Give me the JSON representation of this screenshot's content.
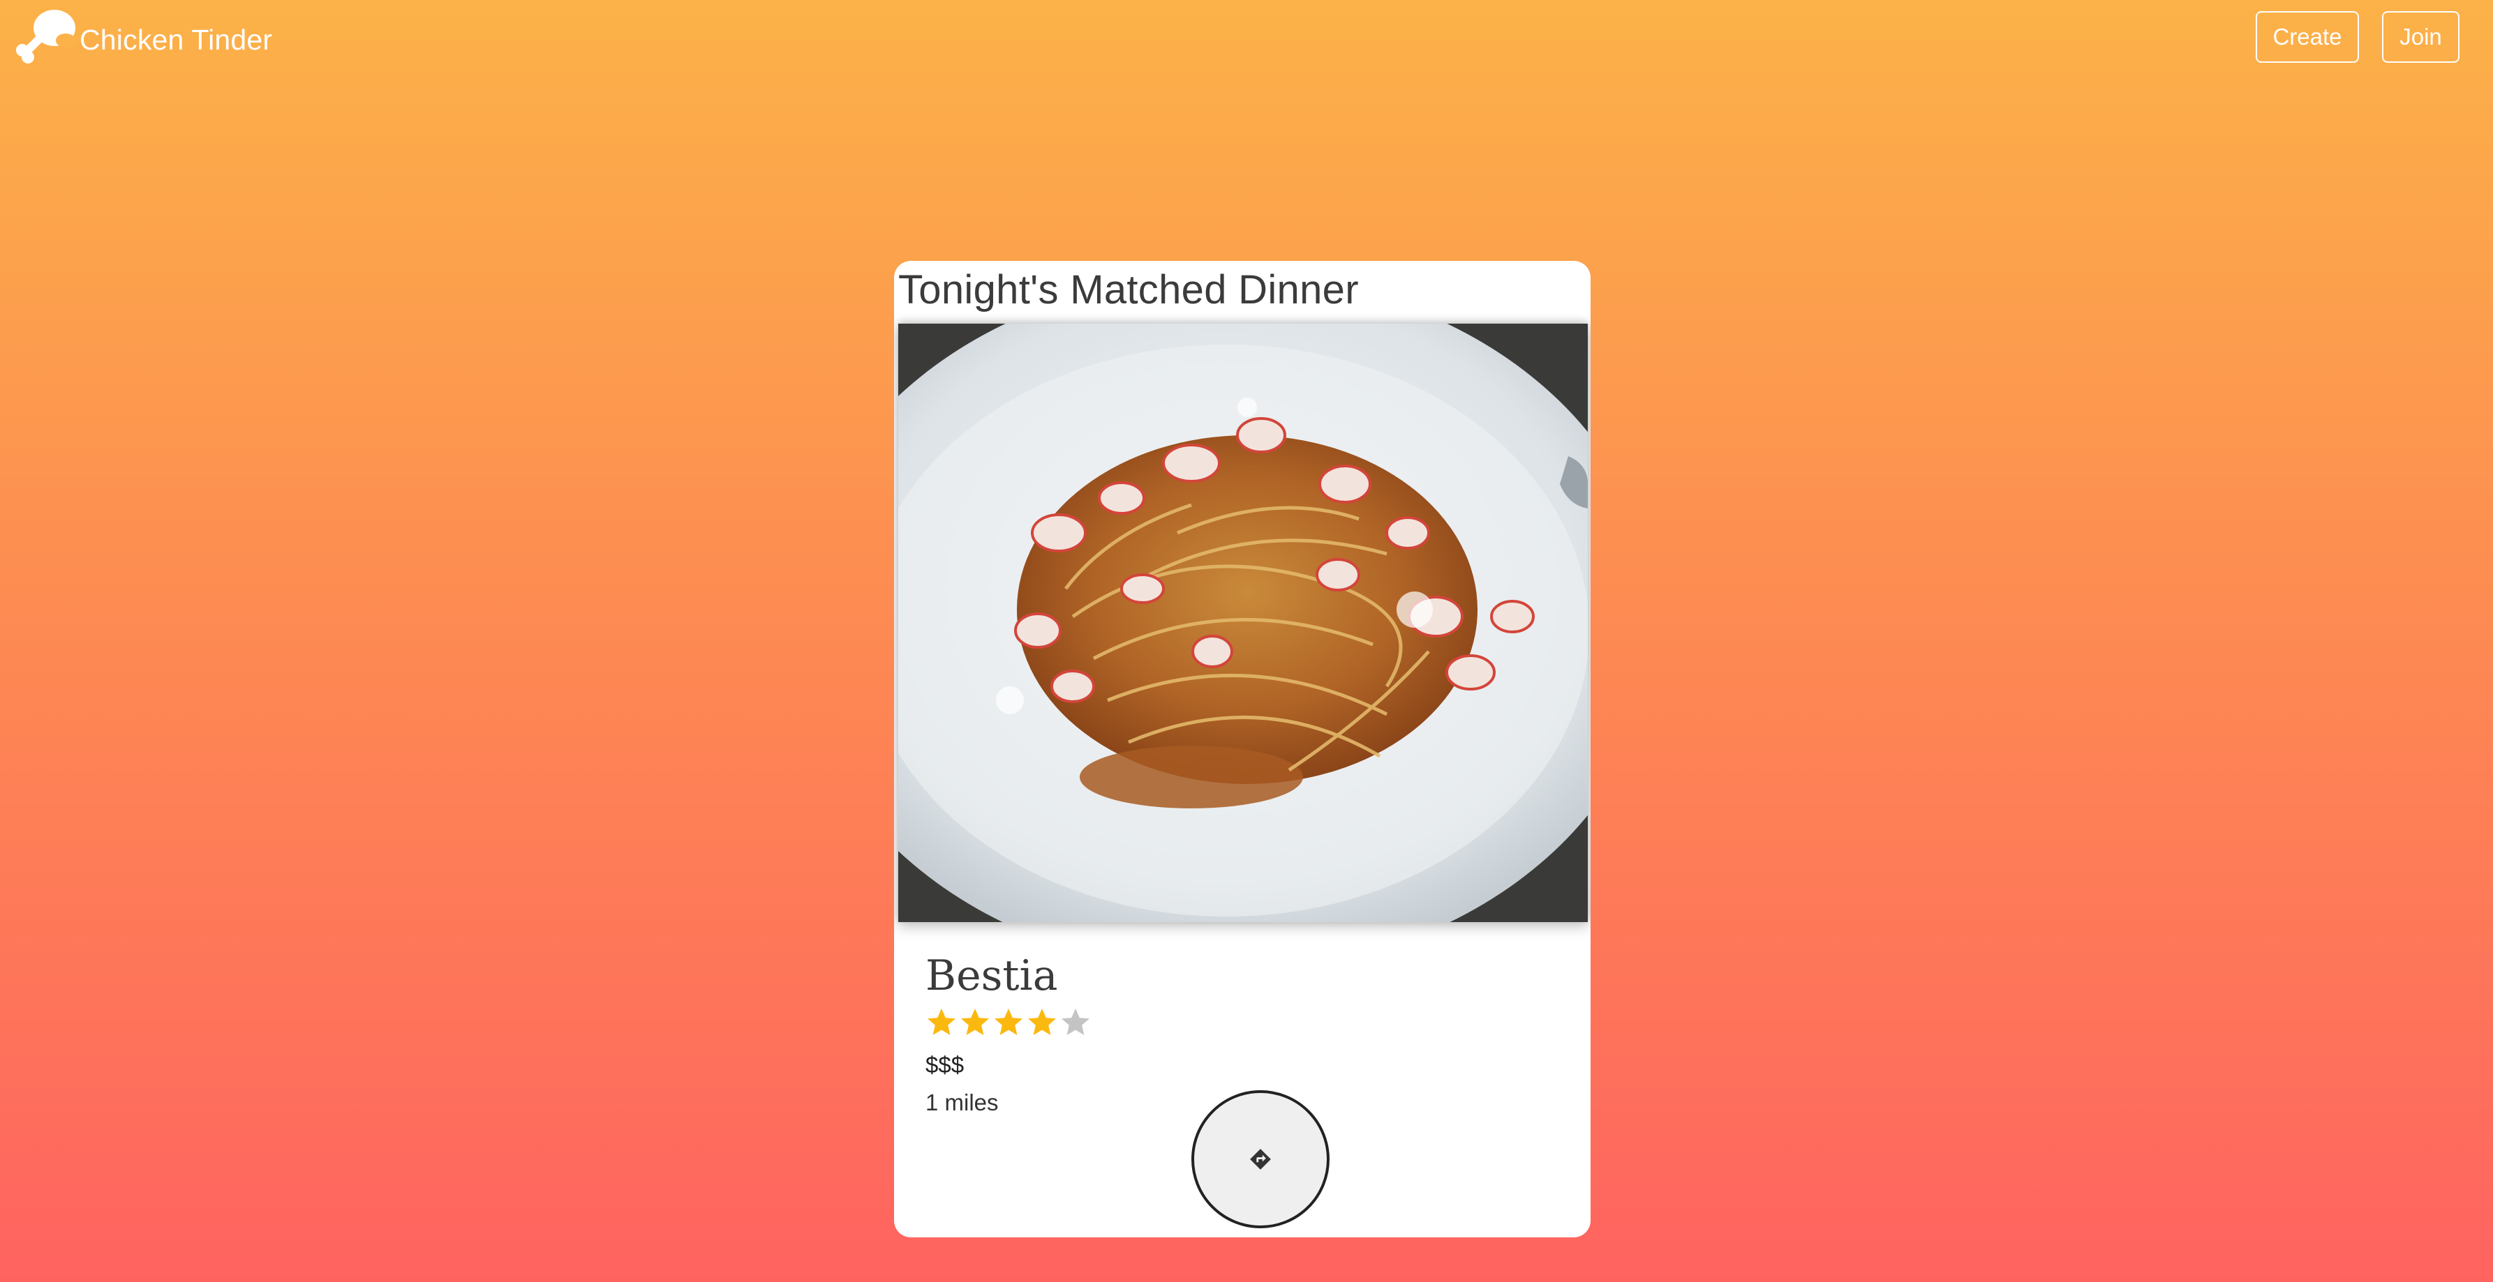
{
  "app": {
    "brand_name": "Chicken Tinder",
    "logo_icon": "chicken-drumstick-icon"
  },
  "nav": {
    "create_label": "Create",
    "join_label": "Join"
  },
  "card": {
    "title": "Tonight's Matched Dinner",
    "image_subject": "food-photo",
    "restaurant": {
      "name": "Bestia",
      "rating": 4,
      "rating_max": 5,
      "price": "$$$",
      "distance": "1 miles"
    },
    "directions_icon": "directions-sign-icon"
  },
  "colors": {
    "gradient_top": "#fcb248",
    "gradient_bottom": "#ff6360",
    "star_filled": "#fbb80f",
    "star_empty": "#c4c4c4",
    "card_bg": "#ffffff",
    "title_text": "#3b3b3b"
  }
}
